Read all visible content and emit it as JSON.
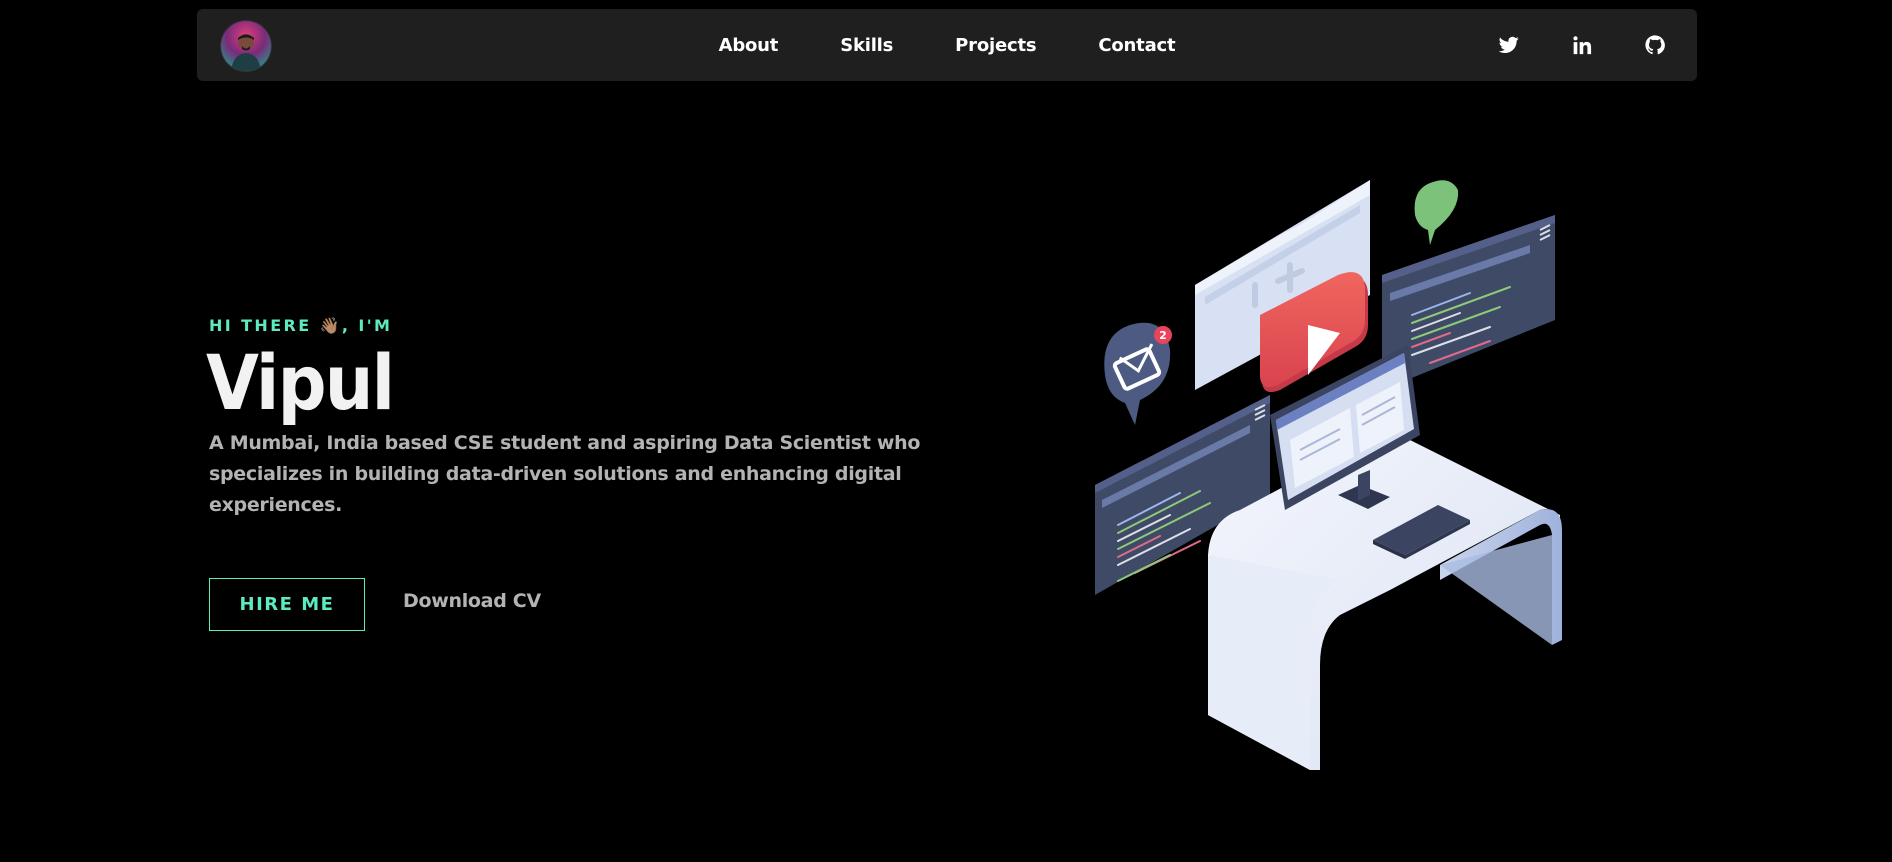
{
  "nav": {
    "links": [
      "About",
      "Skills",
      "Projects",
      "Contact"
    ],
    "socials": [
      "twitter-icon",
      "linkedin-icon",
      "github-icon"
    ]
  },
  "hero": {
    "greeting": "HI THERE 👋🏽, I'M",
    "name": "Vipul",
    "description": "A Mumbai, India based CSE student and aspiring Data Scientist who specializes in building data-driven solutions and enhancing digital experiences.",
    "hire_label": "HIRE ME",
    "cv_label": "Download CV"
  },
  "illustration": {
    "notification_count": "2"
  },
  "colors": {
    "accent": "#5eeac0",
    "background": "#000000",
    "navbar": "#1f1f1f"
  }
}
